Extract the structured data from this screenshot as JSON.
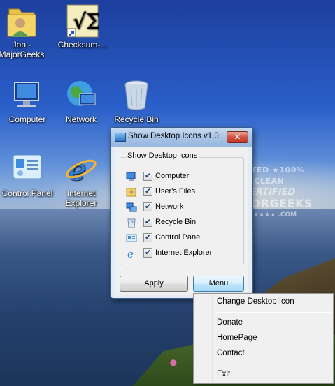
{
  "desktop": {
    "icons": [
      {
        "label": "Jon -\nMajorGeeks",
        "line1": "Jon -",
        "line2": "MajorGeeks",
        "icon": "user-folder-icon"
      },
      {
        "label": "Checksum-...",
        "line1": "Checksum-...",
        "line2": "",
        "icon": "checksum-shortcut-icon"
      },
      {
        "label": "Computer",
        "line1": "Computer",
        "line2": "",
        "icon": "computer-icon"
      },
      {
        "label": "Network",
        "line1": "Network",
        "line2": "",
        "icon": "network-icon"
      },
      {
        "label": "Recycle Bin",
        "line1": "Recycle Bin",
        "line2": "",
        "icon": "recycle-bin-icon"
      },
      {
        "label": "Control Panel",
        "line1": "Control Panel",
        "line2": "",
        "icon": "control-panel-icon"
      },
      {
        "label": "Internet Explorer",
        "line1": "Internet",
        "line2": "Explorer",
        "icon": "internet-explorer-icon"
      }
    ]
  },
  "watermark": {
    "line1": "TESTED ★100% CLEAN",
    "line2": "CERTIFIED",
    "line3": "MAJORGEEKS",
    "line4": "★★★★★★ .COM"
  },
  "dialog": {
    "title": "Show Desktop Icons v1.0",
    "close_glyph": "✕",
    "group_label": "Show Desktop Icons",
    "items": [
      {
        "label": "Computer",
        "checked": true,
        "icon": "computer-icon"
      },
      {
        "label": "User's Files",
        "checked": true,
        "icon": "user-files-icon"
      },
      {
        "label": "Network",
        "checked": true,
        "icon": "network-icon"
      },
      {
        "label": "Recycle Bin",
        "checked": true,
        "icon": "recycle-bin-icon"
      },
      {
        "label": "Control Panel",
        "checked": true,
        "icon": "control-panel-icon"
      },
      {
        "label": "Internet Explorer",
        "checked": true,
        "icon": "internet-explorer-icon"
      }
    ],
    "apply_label": "Apply",
    "menu_label": "Menu"
  },
  "context_menu": {
    "items": [
      "Change Desktop Icon",
      "Donate",
      "HomePage",
      "Contact",
      "Exit"
    ]
  }
}
